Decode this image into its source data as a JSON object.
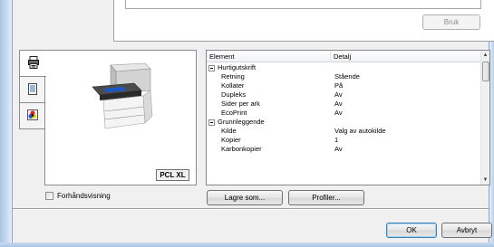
{
  "top_panel": {
    "apply_button_label": "Bruk"
  },
  "tabs": [
    {
      "icon": "printer-settings-icon",
      "active": true
    },
    {
      "icon": "document-icon",
      "active": false
    },
    {
      "icon": "color-palette-icon",
      "active": false
    }
  ],
  "preview": {
    "pdl_label": "PCL XL",
    "preview_checkbox_label": "Forhåndsvisning",
    "preview_checked": false
  },
  "grid": {
    "columns": [
      "Element",
      "Detalj"
    ],
    "rows": [
      {
        "type": "group",
        "label": "Hurtigutskrift",
        "value": ""
      },
      {
        "type": "item",
        "label": "Retning",
        "value": "Stående"
      },
      {
        "type": "item",
        "label": "Kollater",
        "value": "På"
      },
      {
        "type": "item",
        "label": "Dupleks",
        "value": "Av"
      },
      {
        "type": "item",
        "label": "Sider per ark",
        "value": "Av"
      },
      {
        "type": "item",
        "label": "EcoPrint",
        "value": "Av"
      },
      {
        "type": "group",
        "label": "Grunnleggende",
        "value": ""
      },
      {
        "type": "item",
        "label": "Kilde",
        "value": "Valg av autokilde"
      },
      {
        "type": "item",
        "label": "Kopier",
        "value": "1"
      },
      {
        "type": "item",
        "label": "Karbonkopier",
        "value": "Av"
      }
    ]
  },
  "actions": {
    "save_as_label": "Lagre som...",
    "profiles_label": "Profiler..."
  },
  "footer": {
    "ok_label": "OK",
    "cancel_label": "Avbryt"
  }
}
